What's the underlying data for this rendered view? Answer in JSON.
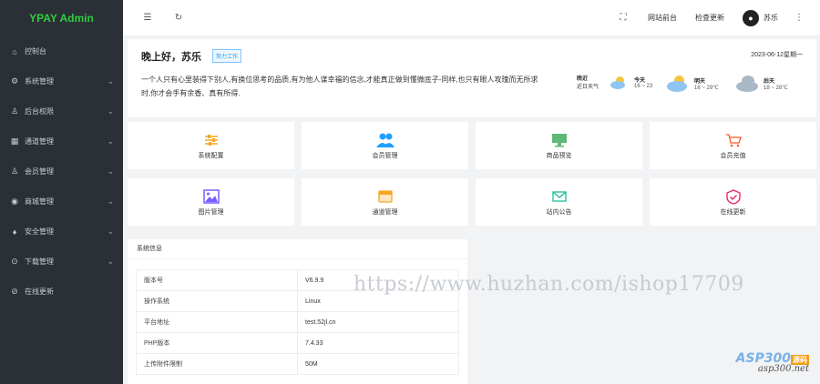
{
  "brand": "YPAY Admin",
  "sidebar": {
    "items": [
      {
        "label": "控制台",
        "icon": "home-icon",
        "has_children": false
      },
      {
        "label": "系统管理",
        "icon": "gear-icon",
        "has_children": true
      },
      {
        "label": "后台权限",
        "icon": "user-icon",
        "has_children": true
      },
      {
        "label": "通道管理",
        "icon": "grid-icon",
        "has_children": true
      },
      {
        "label": "会员管理",
        "icon": "user-icon",
        "has_children": true
      },
      {
        "label": "商城管理",
        "icon": "shop-icon",
        "has_children": true
      },
      {
        "label": "安全管理",
        "icon": "diamond-icon",
        "has_children": true
      },
      {
        "label": "下载管理",
        "icon": "download-icon",
        "has_children": true
      },
      {
        "label": "在线更新",
        "icon": "shield-icon",
        "has_children": false
      }
    ]
  },
  "topbar": {
    "menu_icon": "hamburger-icon",
    "refresh_icon": "refresh-icon",
    "fullscreen_icon": "fullscreen-icon",
    "site_front": "网站前台",
    "check_update": "检查更新",
    "user_name": "苏乐",
    "more_icon": "more-vertical-icon"
  },
  "greeting": {
    "title": "晚上好，苏乐",
    "badge": "努力工作",
    "date": "2023-06-12星期一",
    "text": "一个人只有心里装得下别人,有换位思考的品质,有为他人谋幸福的信念,才能真正做到懂微底子-同样,也只有眼人攻瑰而无所求时,你才会手有余香、真有所得.",
    "weather_title": "晚近",
    "weather_sub": "近日天气",
    "forecast": [
      {
        "day": "今天",
        "range": "16 ~ 23"
      },
      {
        "day": "明天",
        "range": "16 ~ 29℃"
      },
      {
        "day": "后天",
        "range": "18 ~ 28℃"
      }
    ]
  },
  "tiles": [
    {
      "label": "系统配置",
      "icon": "sliders-icon",
      "color": "#f5a623"
    },
    {
      "label": "会员管理",
      "icon": "users-icon",
      "color": "#1e9fff"
    },
    {
      "label": "商品预览",
      "icon": "monitor-icon",
      "color": "#5fb878"
    },
    {
      "label": "会员充值",
      "icon": "cart-icon",
      "color": "#ff5722"
    },
    {
      "label": "图片管理",
      "icon": "image-icon",
      "color": "#7b5cff"
    },
    {
      "label": "通道管理",
      "icon": "window-icon",
      "color": "#f5a623"
    },
    {
      "label": "站内公告",
      "icon": "mail-icon",
      "color": "#1abc9c"
    },
    {
      "label": "在线更新",
      "icon": "shield-check-icon",
      "color": "#e91e63"
    }
  ],
  "system_info": {
    "title": "系统信息",
    "rows": [
      {
        "key": "版本号",
        "value": "V6.9.9"
      },
      {
        "key": "操作系统",
        "value": "Linux"
      },
      {
        "key": "平台地址",
        "value": "test.52jl.cn"
      },
      {
        "key": "PHP版本",
        "value": "7.4.33"
      },
      {
        "key": "上传附件限制",
        "value": "50M"
      }
    ]
  },
  "watermark": {
    "url": "https://www.huzhan.com/ishop17709",
    "logo_main": "ASP300",
    "logo_tag": "源码",
    "logo_site": "asp300.net"
  }
}
